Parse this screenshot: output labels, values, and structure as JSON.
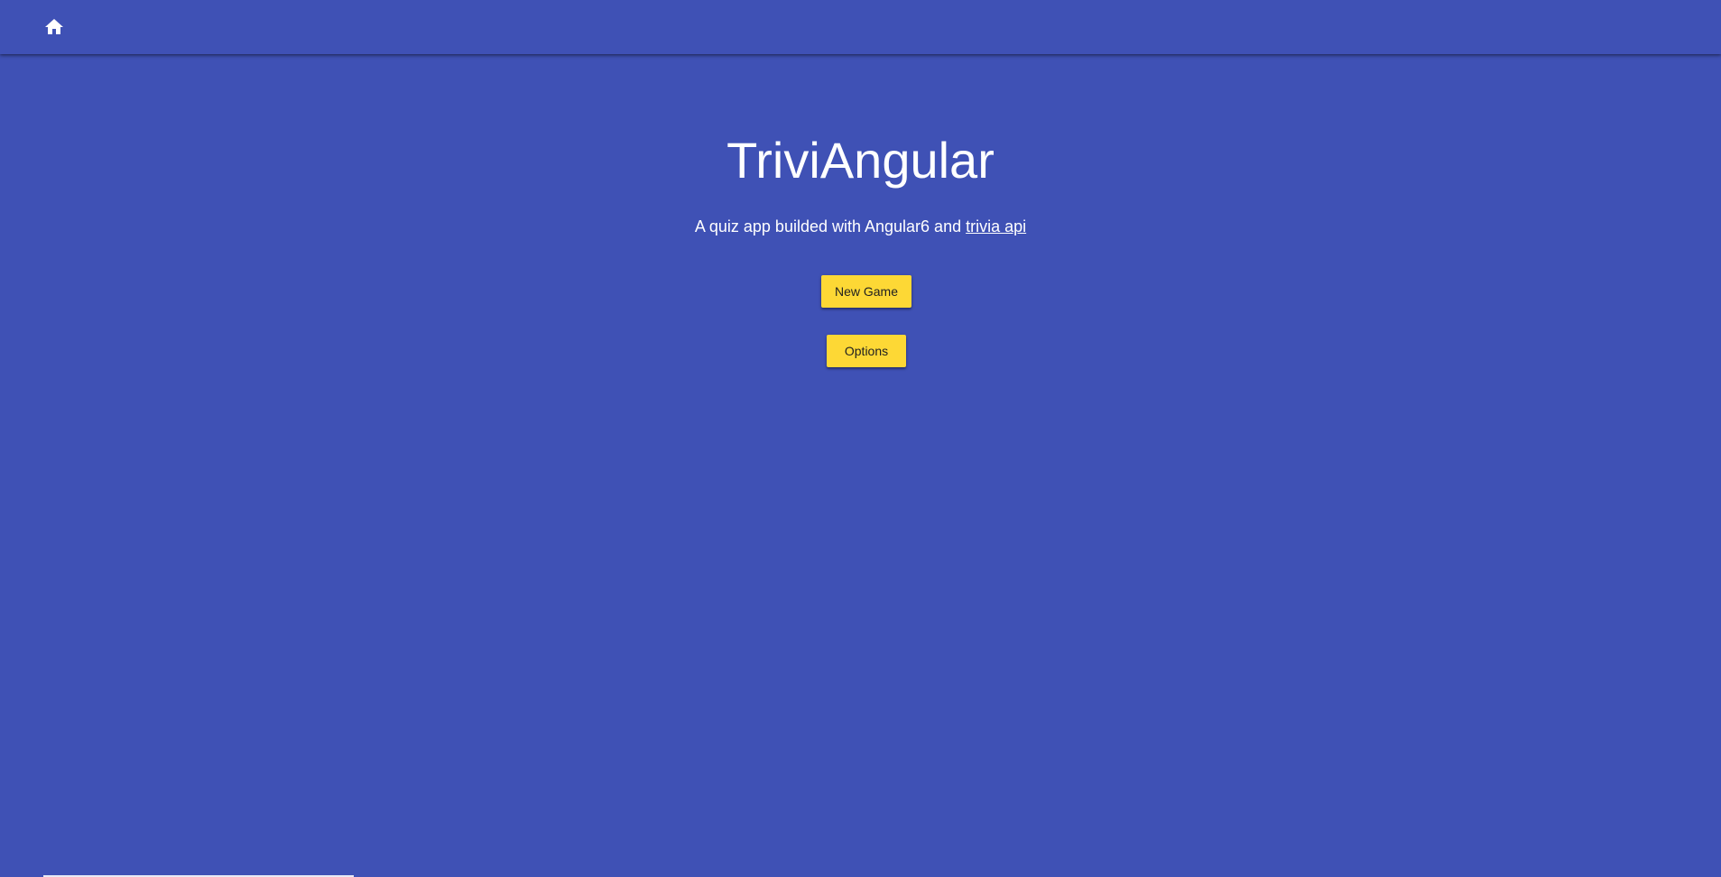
{
  "app": {
    "accent_color": "#fdd835",
    "primary_color": "#3f51b5"
  },
  "toolbar": {
    "home_icon": "home-icon"
  },
  "main": {
    "title": "TriviAngular",
    "subtitle_prefix": "A quiz app builded with Angular6 and ",
    "subtitle_link": "trivia api",
    "new_game_label": "New Game",
    "options_label": "Options"
  }
}
